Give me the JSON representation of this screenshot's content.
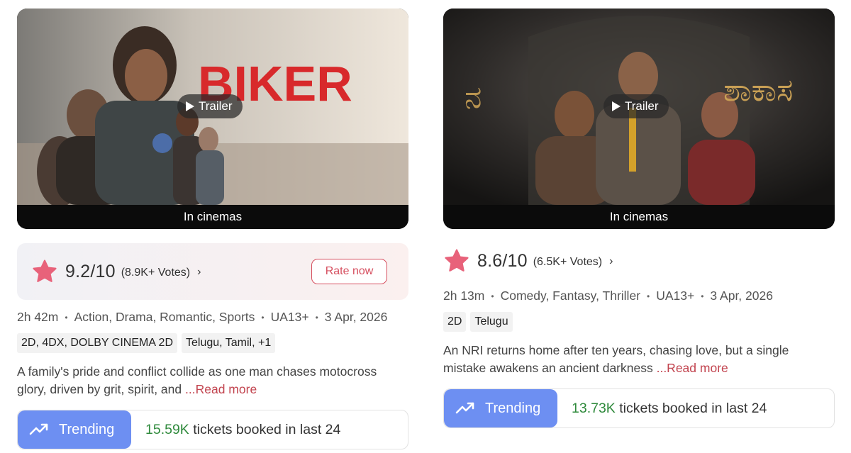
{
  "movies": [
    {
      "trailer_label": "Trailer",
      "caption": "In cinemas",
      "poster_title": "BIKER",
      "rating": "9.2/10",
      "votes": "(8.9K+ Votes)",
      "chevron": "›",
      "rate_now": "Rate now",
      "duration": "2h 42m",
      "genres": "Action, Drama, Romantic, Sports",
      "certificate": "UA13+",
      "release_date": "3 Apr, 2026",
      "formats": "2D, 4DX, DOLBY CINEMA 2D",
      "languages": "Telugu, Tamil, +1",
      "description": "A family's pride and conflict collide as one man chases motocross glory, driven by grit, spirit, and",
      "read_more": "...Read more",
      "trending_label": "Trending",
      "tickets_count": "15.59K",
      "tickets_text": " tickets booked in last 24"
    },
    {
      "trailer_label": "Trailer",
      "caption": "In cinemas",
      "poster_title": "ಶಾಕಾಸ",
      "rating": "8.6/10",
      "votes": "(6.5K+ Votes)",
      "chevron": "›",
      "duration": "2h 13m",
      "genres": "Comedy, Fantasy, Thriller",
      "certificate": "UA13+",
      "release_date": "3 Apr, 2026",
      "format": "2D",
      "language": "Telugu",
      "description": "An NRI returns home after ten years, chasing love, but a single mistake awakens an ancient darkness",
      "read_more": "...Read more",
      "trending_label": "Trending",
      "tickets_count": "13.73K",
      "tickets_text": " tickets booked in last 24"
    }
  ],
  "colors": {
    "accent_red": "#d64f5f",
    "star_pink": "#e8627a",
    "trending_blue": "#6d8ff2",
    "count_green": "#2f8a3c"
  },
  "icons": {
    "play": "play-icon",
    "star": "star-icon",
    "trend": "trending-up-icon",
    "chevron": "chevron-right-icon"
  }
}
